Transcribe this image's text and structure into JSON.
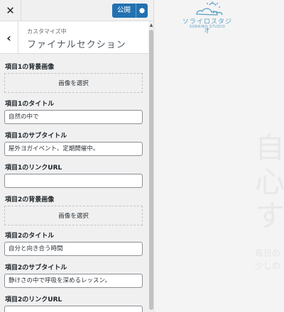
{
  "topbar": {
    "close_icon": "close-icon",
    "publish_label": "公開",
    "gear_icon": "gear-icon"
  },
  "section": {
    "breadcrumb": "カスタマイズ中",
    "title": "ファイナルセクション",
    "back_icon": "chevron-left-icon"
  },
  "controls": [
    {
      "type": "image",
      "label": "項目1の背景画像",
      "button": "画像を選択"
    },
    {
      "type": "text",
      "label": "項目1のタイトル",
      "value": "自然の中で"
    },
    {
      "type": "text",
      "label": "項目1のサブタイトル",
      "value": "屋外ヨガイベント、定期開催中。"
    },
    {
      "type": "text",
      "label": "項目1のリンクURL",
      "value": ""
    },
    {
      "type": "image",
      "label": "項目2の背景画像",
      "button": "画像を選択"
    },
    {
      "type": "text",
      "label": "項目2のタイトル",
      "value": "自分と向き合う時間"
    },
    {
      "type": "text",
      "label": "項目2のサブタイトル",
      "value": "静けさの中で呼吸を深めるレッスン。"
    },
    {
      "type": "text",
      "label": "項目2のリンクURL",
      "value": ""
    }
  ],
  "preview": {
    "logo_jp": "ソライロスタジオ",
    "logo_en": "SORAIRO STUDIO",
    "hero_lines": [
      "自",
      "心",
      "す"
    ],
    "hero_sub": [
      "毎日の",
      "少しの"
    ]
  },
  "colors": {
    "accent": "#2271b1",
    "panel_bg": "#f0f0f1",
    "logo": "#5aa0c8"
  }
}
